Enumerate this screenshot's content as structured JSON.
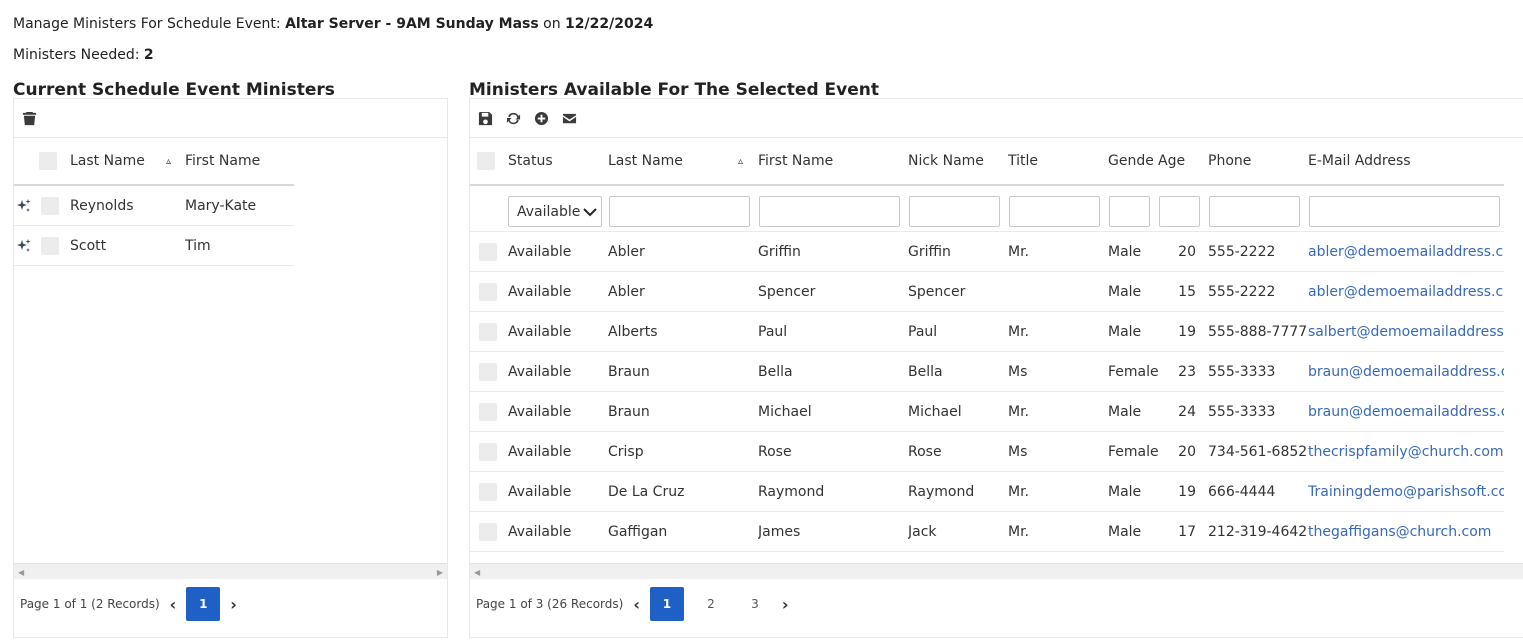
{
  "header": {
    "prefix": "Manage Ministers For Schedule Event: ",
    "ministry": "Altar Server",
    "dash": " - ",
    "event": "9AM Sunday Mass",
    "on": " on ",
    "date": "12/22/2024",
    "needed_label": "Ministers Needed: ",
    "needed_value": "2"
  },
  "current": {
    "title": "Current Schedule Event Ministers",
    "toolbar": {
      "delete_icon": "trash-icon"
    },
    "columns": {
      "last_name": "Last Name",
      "first_name": "First Name",
      "sort_indicator": "▵"
    },
    "rows": [
      {
        "last_name": "Reynolds",
        "first_name": "Mary-Kate",
        "icon": "sparkle-icon"
      },
      {
        "last_name": "Scott",
        "first_name": "Tim",
        "icon": "sparkle-icon"
      }
    ],
    "pager": {
      "summary": "Page 1 of 1 (2 Records)",
      "pages": [
        "1"
      ],
      "active": "1"
    }
  },
  "available": {
    "title": "Ministers Available For The Selected Event",
    "toolbar": {
      "icons": [
        "save-icon",
        "refresh-icon",
        "add-icon",
        "email-icon"
      ]
    },
    "columns": {
      "status": "Status",
      "last_name": "Last Name",
      "sort_indicator": "▵",
      "first_name": "First Name",
      "nick_name": "Nick Name",
      "title": "Title",
      "gender": "Gender",
      "age": "Age",
      "phone": "Phone",
      "email": "E-Mail Address"
    },
    "filter": {
      "status_value": "Available"
    },
    "rows": [
      {
        "status": "Available",
        "last_name": "Abler",
        "first_name": "Griffin",
        "nick_name": "Griffin",
        "title": "Mr.",
        "gender": "Male",
        "age": "20",
        "phone": "555-2222",
        "email": "abler@demoemailaddress.com"
      },
      {
        "status": "Available",
        "last_name": "Abler",
        "first_name": "Spencer",
        "nick_name": "Spencer",
        "title": "",
        "gender": "Male",
        "age": "15",
        "phone": "555-2222",
        "email": "abler@demoemailaddress.com"
      },
      {
        "status": "Available",
        "last_name": "Alberts",
        "first_name": "Paul",
        "nick_name": "Paul",
        "title": "Mr.",
        "gender": "Male",
        "age": "19",
        "phone": "555-888-7777",
        "email": "salbert@demoemailaddress.com"
      },
      {
        "status": "Available",
        "last_name": "Braun",
        "first_name": "Bella",
        "nick_name": "Bella",
        "title": "Ms",
        "gender": "Female",
        "age": "23",
        "phone": "555-3333",
        "email": "braun@demoemailaddress.com"
      },
      {
        "status": "Available",
        "last_name": "Braun",
        "first_name": "Michael",
        "nick_name": "Michael",
        "title": "Mr.",
        "gender": "Male",
        "age": "24",
        "phone": "555-3333",
        "email": "braun@demoemailaddress.com"
      },
      {
        "status": "Available",
        "last_name": "Crisp",
        "first_name": "Rose",
        "nick_name": "Rose",
        "title": "Ms",
        "gender": "Female",
        "age": "20",
        "phone": "734-561-6852",
        "email": "thecrispfamily@church.com"
      },
      {
        "status": "Available",
        "last_name": "De La Cruz",
        "first_name": "Raymond",
        "nick_name": "Raymond",
        "title": "Mr.",
        "gender": "Male",
        "age": "19",
        "phone": "666-4444",
        "email": "Trainingdemo@parishsoft.com"
      },
      {
        "status": "Available",
        "last_name": "Gaffigan",
        "first_name": "James",
        "nick_name": "Jack",
        "title": "Mr.",
        "gender": "Male",
        "age": "17",
        "phone": "212-319-4642",
        "email": "thegaffigans@church.com"
      }
    ],
    "pager": {
      "summary": "Page 1 of 3 (26 Records)",
      "pages": [
        "1",
        "2",
        "3"
      ],
      "active": "1"
    }
  },
  "colors": {
    "accent": "#1f60c6",
    "link": "#3869b5"
  }
}
